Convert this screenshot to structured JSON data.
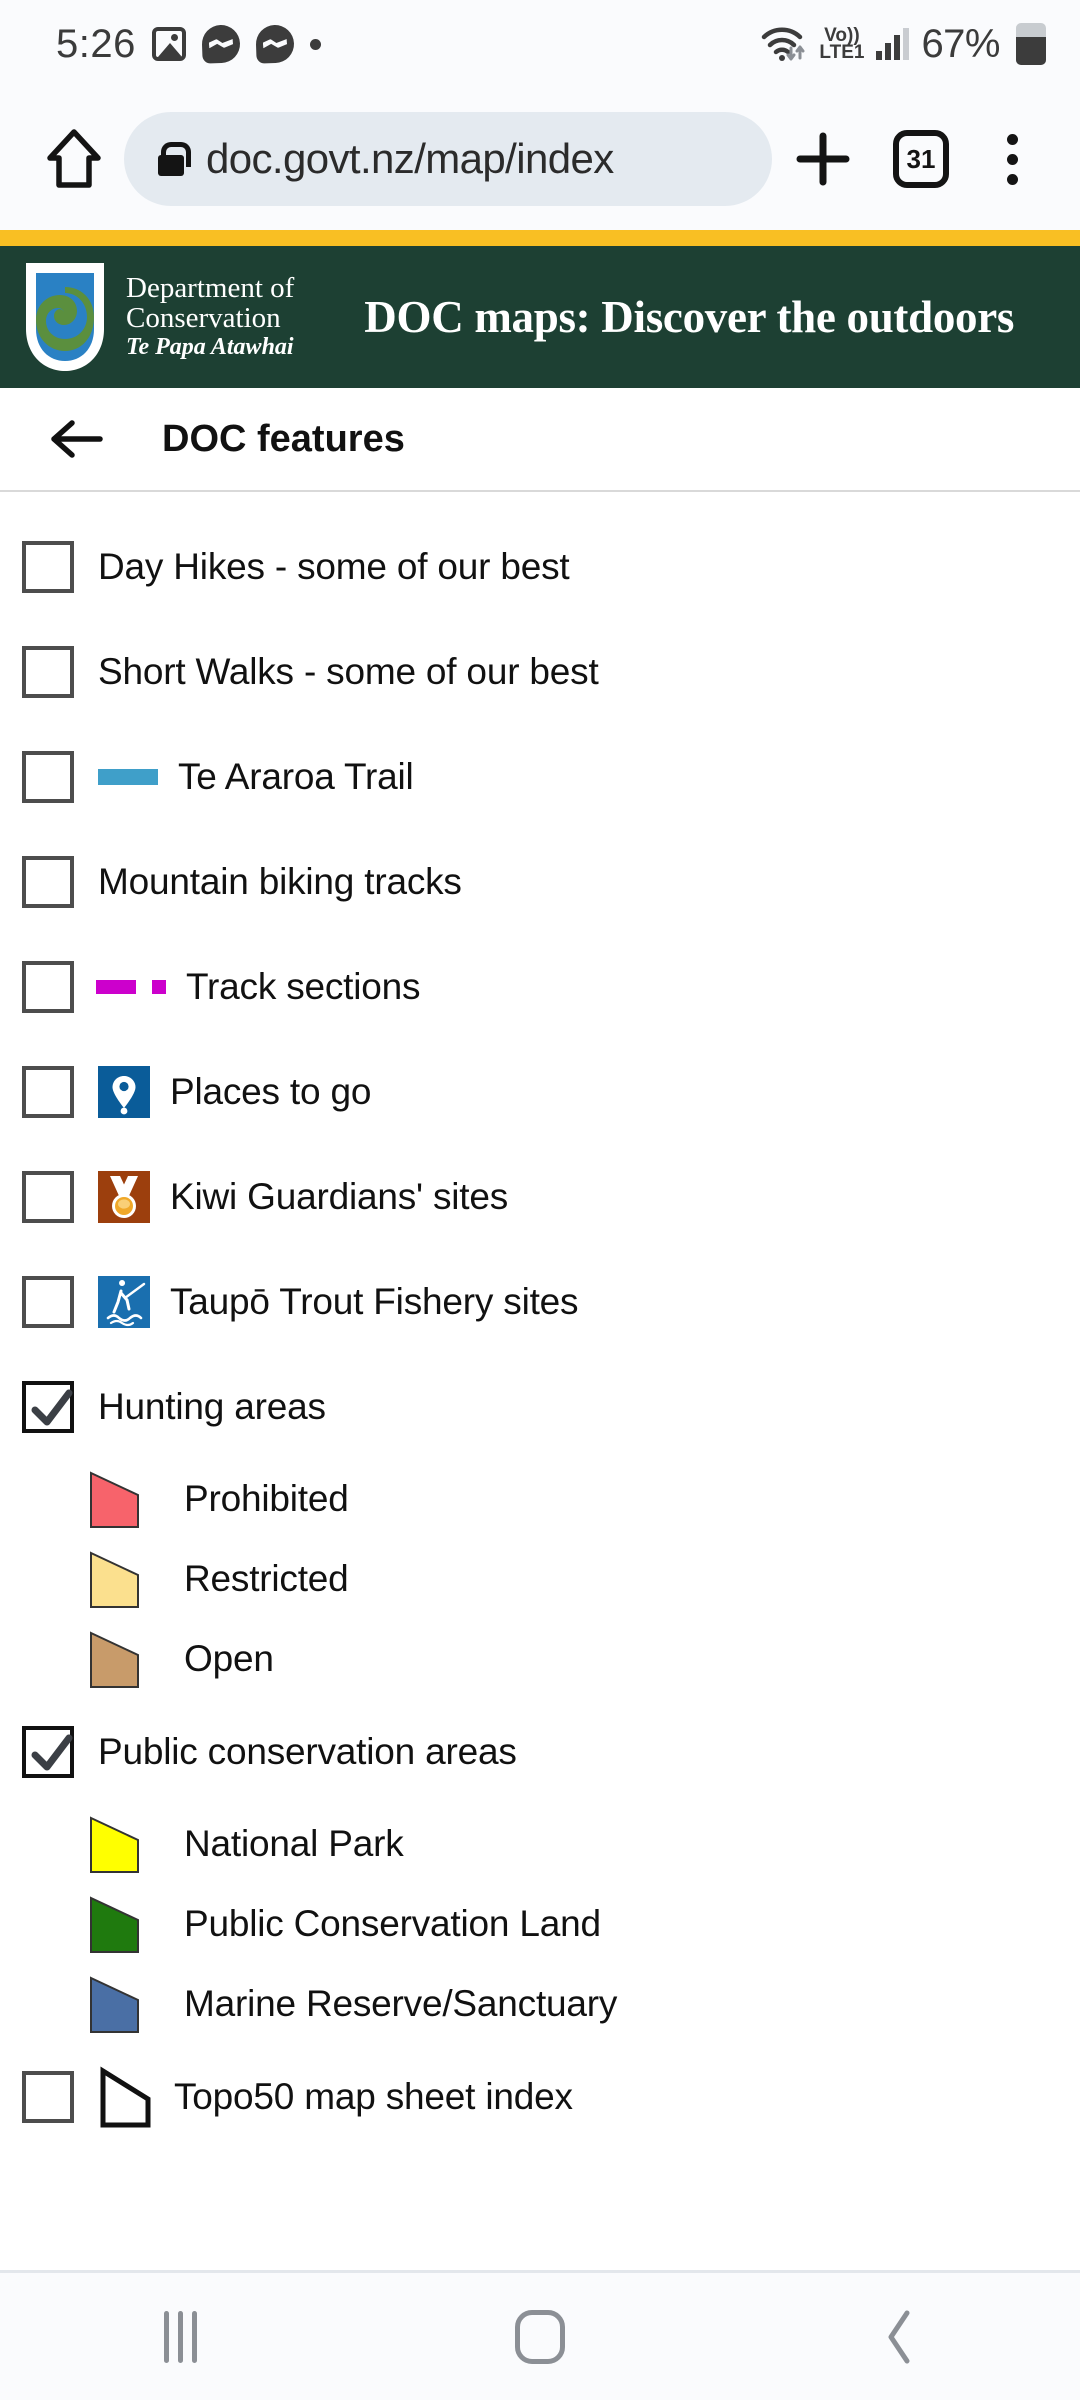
{
  "status_bar": {
    "time": "5:26",
    "icons": [
      "photo-icon",
      "messenger-icon",
      "messenger-icon",
      "dot-icon"
    ],
    "wifi": "wifi-icon",
    "network_label_top": "Vo))",
    "network_label_bottom": "LTE1",
    "signal": "signal-bars-icon",
    "battery_percent": "67%",
    "battery": "battery-icon"
  },
  "browser": {
    "home_icon": "home-icon",
    "lock_icon": "lock-icon",
    "url": "doc.govt.nz/map/index",
    "new_tab_icon": "plus-icon",
    "tab_count": "31",
    "menu_icon": "overflow-menu-icon"
  },
  "site_header": {
    "gold_accent": "#f9bf23",
    "background": "#1d4033",
    "logo": {
      "line1": "Department of",
      "line2": "Conservation",
      "line3": "Te Papa Atawhai"
    },
    "title": "DOC maps: Discover the outdoors"
  },
  "panel": {
    "back_icon": "back-arrow-icon",
    "title": "DOC features"
  },
  "features": [
    {
      "label": "Day Hikes - some of our best",
      "checked": false,
      "symbol": "none"
    },
    {
      "label": "Short Walks - some of our best",
      "checked": false,
      "symbol": "none"
    },
    {
      "label": "Te Araroa Trail",
      "checked": false,
      "symbol": "line",
      "color": "#3f9fc9"
    },
    {
      "label": "Mountain biking tracks",
      "checked": false,
      "symbol": "none"
    },
    {
      "label": "Track sections",
      "checked": false,
      "symbol": "dashed-line",
      "color": "#cc00cc"
    },
    {
      "label": "Places to go",
      "checked": false,
      "symbol": "icon",
      "icon": "map-pin-icon",
      "color": "#0a5c99"
    },
    {
      "label": "Kiwi Guardians' sites",
      "checked": false,
      "symbol": "icon",
      "icon": "medal-icon",
      "color": "#9c3f0d"
    },
    {
      "label": "Taupō Trout Fishery sites",
      "checked": false,
      "symbol": "icon",
      "icon": "fly-fishing-icon",
      "color": "#1a6faf"
    }
  ],
  "hunting": {
    "label": "Hunting areas",
    "checked": true,
    "legend": [
      {
        "label": "Prohibited",
        "color": "#f7636b"
      },
      {
        "label": "Restricted",
        "color": "#fbe08e"
      },
      {
        "label": "Open",
        "color": "#c89b6a"
      }
    ]
  },
  "conservation": {
    "label": "Public conservation areas",
    "checked": true,
    "legend": [
      {
        "label": "National Park",
        "color": "#ffff00"
      },
      {
        "label": "Public Conservation Land",
        "color": "#1f7a0e"
      },
      {
        "label": "Marine Reserve/Sanctuary",
        "color": "#4a6fa5"
      }
    ]
  },
  "topo": {
    "label": "Topo50 map sheet index",
    "checked": false,
    "symbol": "polygon-outline"
  },
  "nav_bar": {
    "recents": "recents-icon",
    "home": "home-icon",
    "back": "back-icon"
  }
}
